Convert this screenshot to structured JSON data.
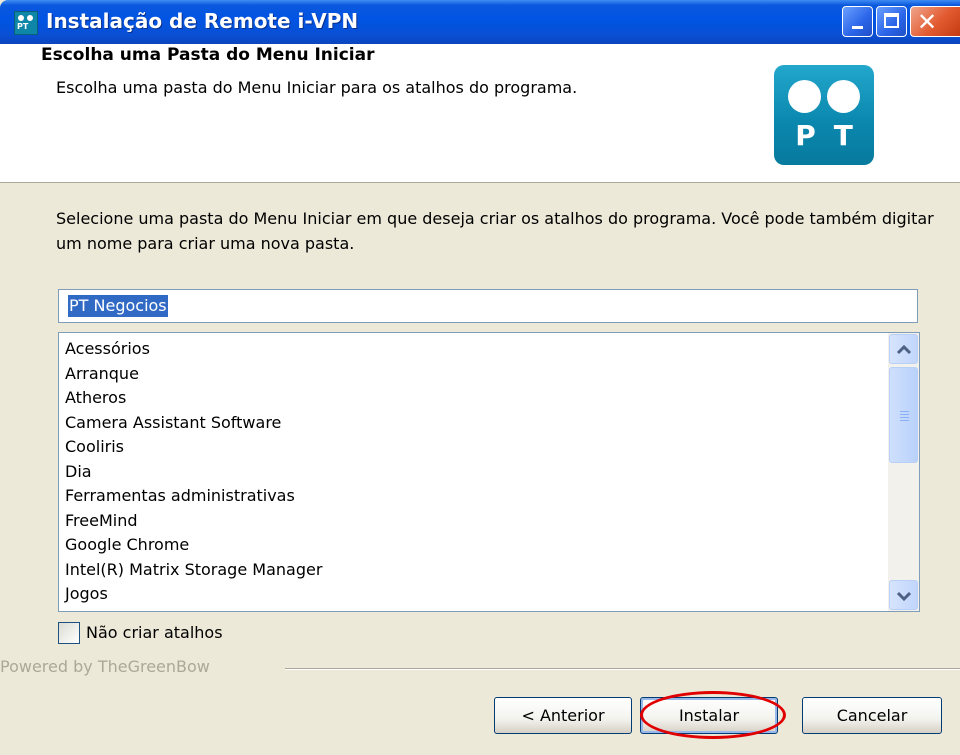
{
  "window": {
    "title": "Instalação de Remote i-VPN",
    "app_icon_text": "PT",
    "controls": [
      "minimize-icon",
      "maximize-icon",
      "close-icon"
    ]
  },
  "header": {
    "title": "Escolha uma Pasta do Menu Iniciar",
    "subtitle": "Escolha uma pasta do Menu Iniciar para os atalhos do programa.",
    "logo_text": "PT"
  },
  "body": {
    "description": "Selecione uma pasta do Menu Iniciar em que deseja criar os atalhos do programa. Você pode também digitar um nome para criar uma nova pasta.",
    "folder_input_value": "PT Negocios",
    "folders": [
      "Acessórios",
      "Arranque",
      "Atheros",
      "Camera Assistant Software",
      "Cooliris",
      "Dia",
      "Ferramentas administrativas",
      "FreeMind",
      "Google Chrome",
      "Intel(R) Matrix Storage Manager",
      "Jogos"
    ],
    "no_shortcuts_label": "Não criar atalhos",
    "no_shortcuts_checked": false
  },
  "footer": {
    "powered_by": "Powered by TheGreenBow",
    "buttons": {
      "back": "< Anterior",
      "install": "Instalar",
      "cancel": "Cancelar"
    }
  },
  "colors": {
    "titlebar": "#0054e3",
    "selection": "#316ac5",
    "logo": "#0a86ad",
    "highlight_ring": "#e00000"
  }
}
